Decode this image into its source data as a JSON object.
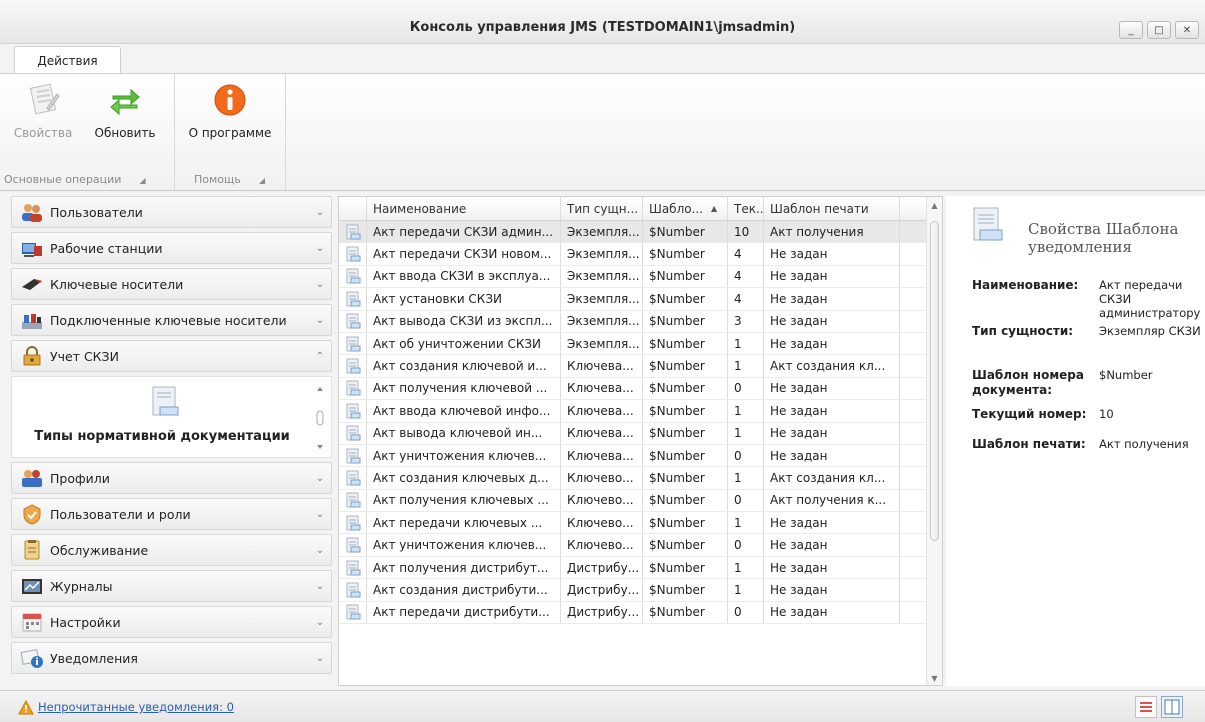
{
  "window": {
    "title": "Консоль управления JMS (TESTDOMAIN1\\jmsadmin)",
    "minimize_glyph": "_",
    "maximize_glyph": "□",
    "close_glyph": "✕"
  },
  "ribbon": {
    "tab_label": "Действия",
    "buttons": {
      "properties": "Свойства",
      "refresh": "Обновить",
      "about": "О программе"
    },
    "groups": {
      "main": "Основные операции",
      "help": "Помощь"
    },
    "launcher_glyph": "◢"
  },
  "nav": {
    "items": [
      {
        "label": "Пользователи",
        "icon": "users-icon"
      },
      {
        "label": "Рабочие станции",
        "icon": "workstation-icon"
      },
      {
        "label": "Ключевые носители",
        "icon": "key-media-icon"
      },
      {
        "label": "Подключенные ключевые носители",
        "icon": "connected-media-icon"
      },
      {
        "label": "Учет СКЗИ",
        "icon": "lock-icon"
      },
      {
        "label": "Профили",
        "icon": "profiles-icon"
      },
      {
        "label": "Пользователи и роли",
        "icon": "roles-icon"
      },
      {
        "label": "Обслуживание",
        "icon": "maintenance-icon"
      },
      {
        "label": "Журналы",
        "icon": "journals-icon"
      },
      {
        "label": "Настройки",
        "icon": "settings-icon"
      },
      {
        "label": "Уведомления",
        "icon": "notifications-icon"
      }
    ],
    "expanded_content_label": "Типы нормативной документации",
    "chevron_down": "⌄",
    "chevron_up": "⌃"
  },
  "grid": {
    "columns": [
      "Наименование",
      "Тип сущн...",
      "Шабло...",
      "Тек...",
      "Шаблон печати"
    ],
    "sort_indicator": "▲",
    "rows": [
      [
        "Акт передачи СКЗИ админ...",
        "Экземпля...",
        "$Number",
        "10",
        "Акт получения"
      ],
      [
        "Акт передачи СКЗИ новом...",
        "Экземпля...",
        "$Number",
        "4",
        "Не задан"
      ],
      [
        "Акт ввода СКЗИ в эксплуа...",
        "Экземпля...",
        "$Number",
        "4",
        "Не задан"
      ],
      [
        "Акт установки СКЗИ",
        "Экземпля...",
        "$Number",
        "4",
        "Не задан"
      ],
      [
        "Акт вывода СКЗИ из экспл...",
        "Экземпля...",
        "$Number",
        "3",
        "Не задан"
      ],
      [
        "Акт об уничтожении СКЗИ",
        "Экземпля...",
        "$Number",
        "1",
        "Не задан"
      ],
      [
        "Акт создания ключевой и...",
        "Ключева...",
        "$Number",
        "1",
        "Акт создания кл..."
      ],
      [
        "Акт получения ключевой ...",
        "Ключева...",
        "$Number",
        "0",
        "Не задан"
      ],
      [
        "Акт ввода ключевой инфо...",
        "Ключева...",
        "$Number",
        "1",
        "Не задан"
      ],
      [
        "Акт вывода ключевой ин...",
        "Ключева...",
        "$Number",
        "1",
        "Не задан"
      ],
      [
        "Акт уничтожения ключев...",
        "Ключева...",
        "$Number",
        "0",
        "Не задан"
      ],
      [
        "Акт создания ключевых д...",
        "Ключево...",
        "$Number",
        "1",
        "Акт создания кл..."
      ],
      [
        "Акт получения ключевых ...",
        "Ключево...",
        "$Number",
        "0",
        "Акт получения к..."
      ],
      [
        "Акт передачи ключевых ...",
        "Ключево...",
        "$Number",
        "1",
        "Не задан"
      ],
      [
        "Акт уничтожения ключев...",
        "Ключево...",
        "$Number",
        "0",
        "Не задан"
      ],
      [
        "Акт получения дистрибут...",
        "Дистрибу...",
        "$Number",
        "1",
        "Не задан"
      ],
      [
        "Акт создания дистрибути...",
        "Дистрибу...",
        "$Number",
        "1",
        "Не задан"
      ],
      [
        "Акт передачи дистрибути...",
        "Дистрибу...",
        "$Number",
        "0",
        "Не задан"
      ]
    ],
    "selected_row": 0
  },
  "properties": {
    "title": "Свойства Шаблона уведомления",
    "fields": [
      {
        "label": "Наименование:",
        "value": "Акт передачи СКЗИ администратору"
      },
      {
        "label": "Тип сущности:",
        "value": "Экземпляр СКЗИ"
      },
      {
        "label": "Шаблон номера документа:",
        "value": "$Number"
      },
      {
        "label": "Текущий номер:",
        "value": "10"
      },
      {
        "label": "Шаблон печати:",
        "value": "Акт получения"
      }
    ]
  },
  "status": {
    "unread_link": "Непрочитанные уведомления: 0",
    "accent": "#2a5db0",
    "warning_color": "#f0a020"
  }
}
